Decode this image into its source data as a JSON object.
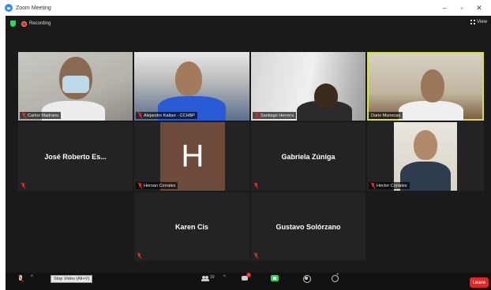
{
  "window": {
    "title": "Zoom Meeting",
    "controls": {
      "minimize": "–",
      "maximize": "▫",
      "close": "✕"
    }
  },
  "topbar": {
    "recording_label": "Recording",
    "view_label": "View"
  },
  "participants": [
    {
      "name": "Carlos Madrano",
      "muted": true,
      "video": true
    },
    {
      "name": "Alejandro Kattan - CCHBP",
      "muted": true,
      "video": true
    },
    {
      "name": "Santiago Herrera",
      "muted": true,
      "video": true
    },
    {
      "name": "Dario Munecas",
      "muted": false,
      "video": true,
      "active_speaker": true
    },
    {
      "name": "José Roberto Es...",
      "muted": true,
      "video": false
    },
    {
      "name": "Hernan Corrales",
      "muted": true,
      "video": false,
      "avatar_letter": "H"
    },
    {
      "name": "Gabriela Zúniga",
      "muted": true,
      "video": false
    },
    {
      "name": "Hector Corrales",
      "muted": true,
      "video": true
    },
    {
      "name": "Karen Cis",
      "muted": true,
      "video": false
    },
    {
      "name": "Gustavo Solórzano",
      "muted": true,
      "video": false
    }
  ],
  "toolbar": {
    "tooltip": "Stop Video (Alt+V)",
    "participants_count": "10",
    "chat_badge": "1",
    "leave_label": "Leave"
  },
  "colors": {
    "active_speaker_border": "#d4e33a",
    "leave_button": "#e02828",
    "share_button": "#23d959",
    "avatar_bg": "#6e4a3a"
  }
}
